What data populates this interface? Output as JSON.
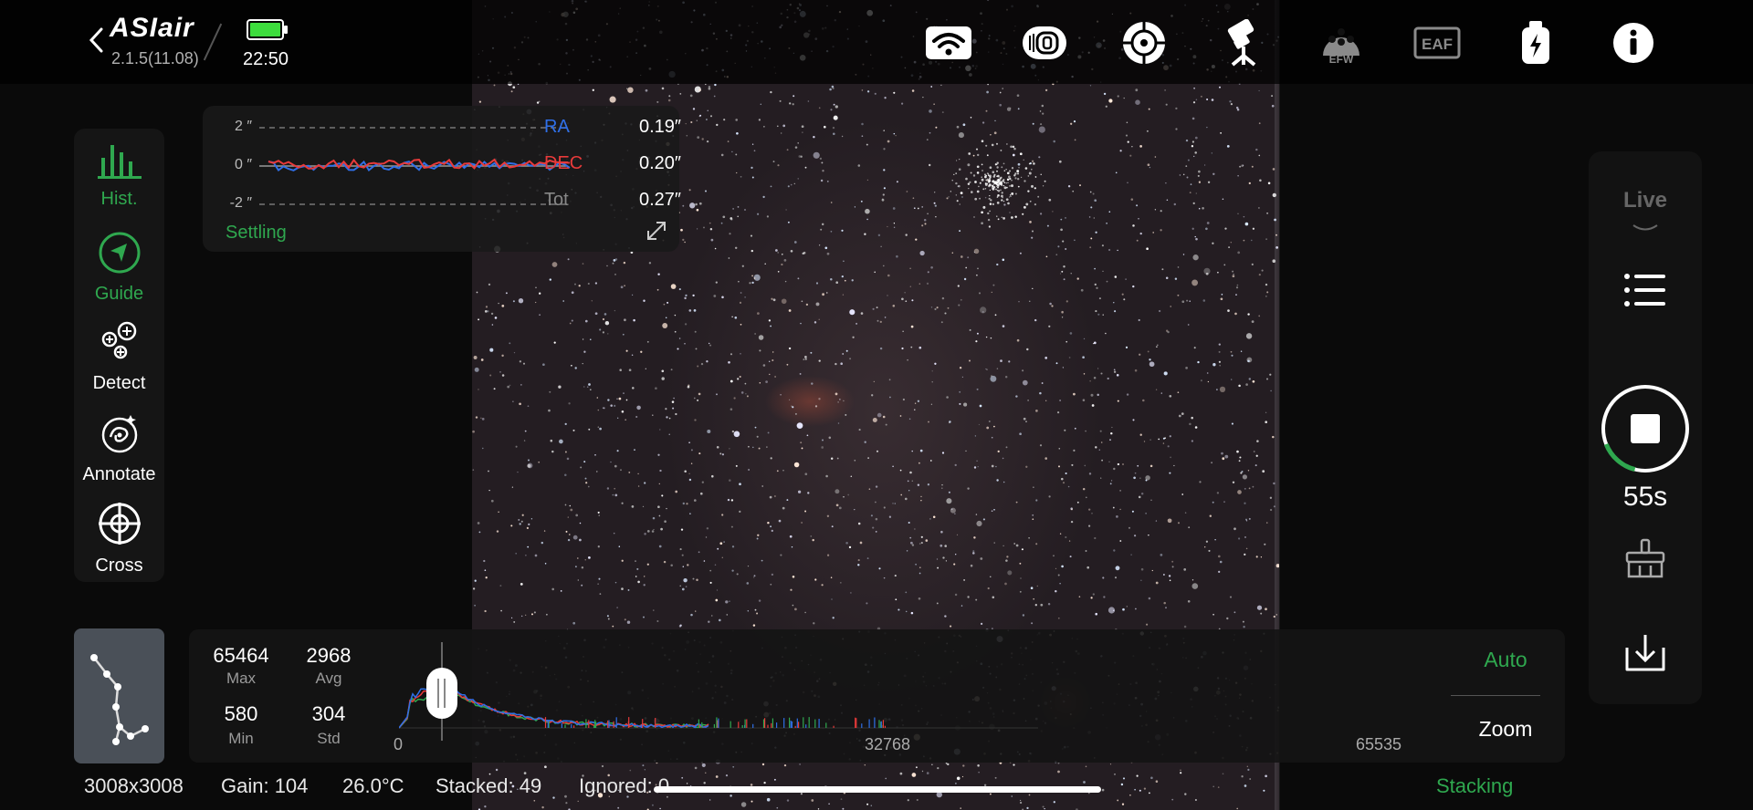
{
  "app": {
    "logo": "ASIair",
    "version": "2.1.5(11.08)",
    "time": "22:50"
  },
  "topbar_icons": [
    "wifi-icon",
    "camera-icon",
    "guide-scope-icon",
    "mount-icon",
    "efw-icon",
    "eaf-icon",
    "power-icon",
    "info-icon"
  ],
  "topbar_icon_text": {
    "efw": "EFW",
    "eaf": "EAF"
  },
  "sidebar": {
    "items": [
      {
        "label": "Hist.",
        "icon": "histogram-icon",
        "active": true
      },
      {
        "label": "Guide",
        "icon": "guide-icon",
        "active": true
      },
      {
        "label": "Detect",
        "icon": "detect-icon",
        "active": false
      },
      {
        "label": "Annotate",
        "icon": "annotate-icon",
        "active": false
      },
      {
        "label": "Cross",
        "icon": "crosshair-icon",
        "active": false
      }
    ]
  },
  "guide_graph": {
    "y_ticks": [
      "2 ″",
      "0 ″",
      "-2 ″"
    ],
    "status": "Settling",
    "ra_label": "RA",
    "ra_value": "0.19″",
    "dec_label": "DEC",
    "dec_value": "0.20″",
    "tot_label": "Tot",
    "tot_value": "0.27″"
  },
  "right_panel": {
    "mode": "Live",
    "countdown": "55s",
    "progress": 0.05
  },
  "histogram": {
    "max": "65464",
    "max_label": "Max",
    "avg": "2968",
    "avg_label": "Avg",
    "min": "580",
    "min_label": "Min",
    "std": "304",
    "std_label": "Std",
    "axis_start": "0",
    "axis_mid": "32768",
    "axis_end": "65535",
    "auto_label": "Auto",
    "zoom_label": "Zoom"
  },
  "status": {
    "resolution": "3008x3008",
    "gain": "Gain: 104",
    "temperature": "26.0°C",
    "stacked": "Stacked: 49",
    "ignored": "Ignored: 0",
    "mode": "Stacking"
  },
  "colors": {
    "accent_green": "#2fa84f",
    "ra_blue": "#2f6fe8",
    "dec_red": "#e83a3a",
    "battery_green": "#3ddc3d"
  }
}
